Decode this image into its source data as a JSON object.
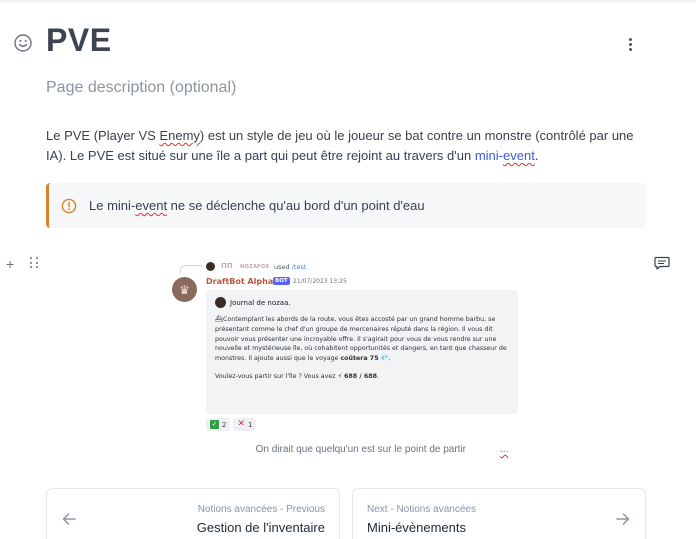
{
  "page": {
    "title": "PVE",
    "description": "Page description (optional)"
  },
  "paragraph": {
    "part1": "Le PVE (Player VS ",
    "squiggle1": "Enemy",
    "part2": ") est un style de jeu où le joueur se bat contre un monstre (contrôlé par une IA). Le PVE est situé sur une île a part qui peut être rejoint au travers d'un ",
    "link_a": "mini-",
    "link_b": "event",
    "part3": "."
  },
  "hint": {
    "pre": "Le mini-",
    "squiggle": "event",
    "post": " ne se déclenche qu'au bord d'un point d'eau"
  },
  "discord": {
    "reply_badge": "ΠΠ",
    "reply_user": "NOZAFOX",
    "reply_used": "used",
    "reply_command": "/test",
    "bot_name": "DraftBot Alpha",
    "bot_tag": "BOT",
    "bot_date": "21/07/2023 13:25",
    "embed_title": "Journal de nozaa.",
    "embed_icon": "⛴",
    "embed_body": "Contemplant les abords de la route, vous êtes accosté par un grand homme barbu, se présentant comme le chef d'un groupe de mercenaires réputé dans la région. Il vous dit pouvoir vous présenter une incroyable offre. Il s'agirait pour vous de vous rendre sur une nouvelle et mystérieuse île, où cohabitent opportunités et dangers, en tant que chasseur de monstres. Il ajoute aussi que le voyage ",
    "embed_cost_label": "coûtera 75",
    "embed_gem": "💎",
    "embed_end": ".",
    "embed_question": "Voulez-vous partir sur l'île ? Vous avez ",
    "embed_energy_icon": "⚡",
    "embed_energy": "688 / 688",
    "embed_question_end": ".",
    "reactions": [
      {
        "count": "2"
      },
      {
        "count": "1"
      }
    ]
  },
  "caption": {
    "text": "On dirait que quelqu'un est sur le point de partir",
    "squiggle": "..."
  },
  "pagination": {
    "prev_meta": "Notions avancées - Previous",
    "prev_title": "Gestion de l'inventaire",
    "next_meta": "Next - Notions avancées",
    "next_title": "Mini-évènements"
  },
  "colors": {
    "accent_link": "#3b5bdb",
    "hint_border": "#d9822b",
    "bot_name": "#b6573f"
  }
}
